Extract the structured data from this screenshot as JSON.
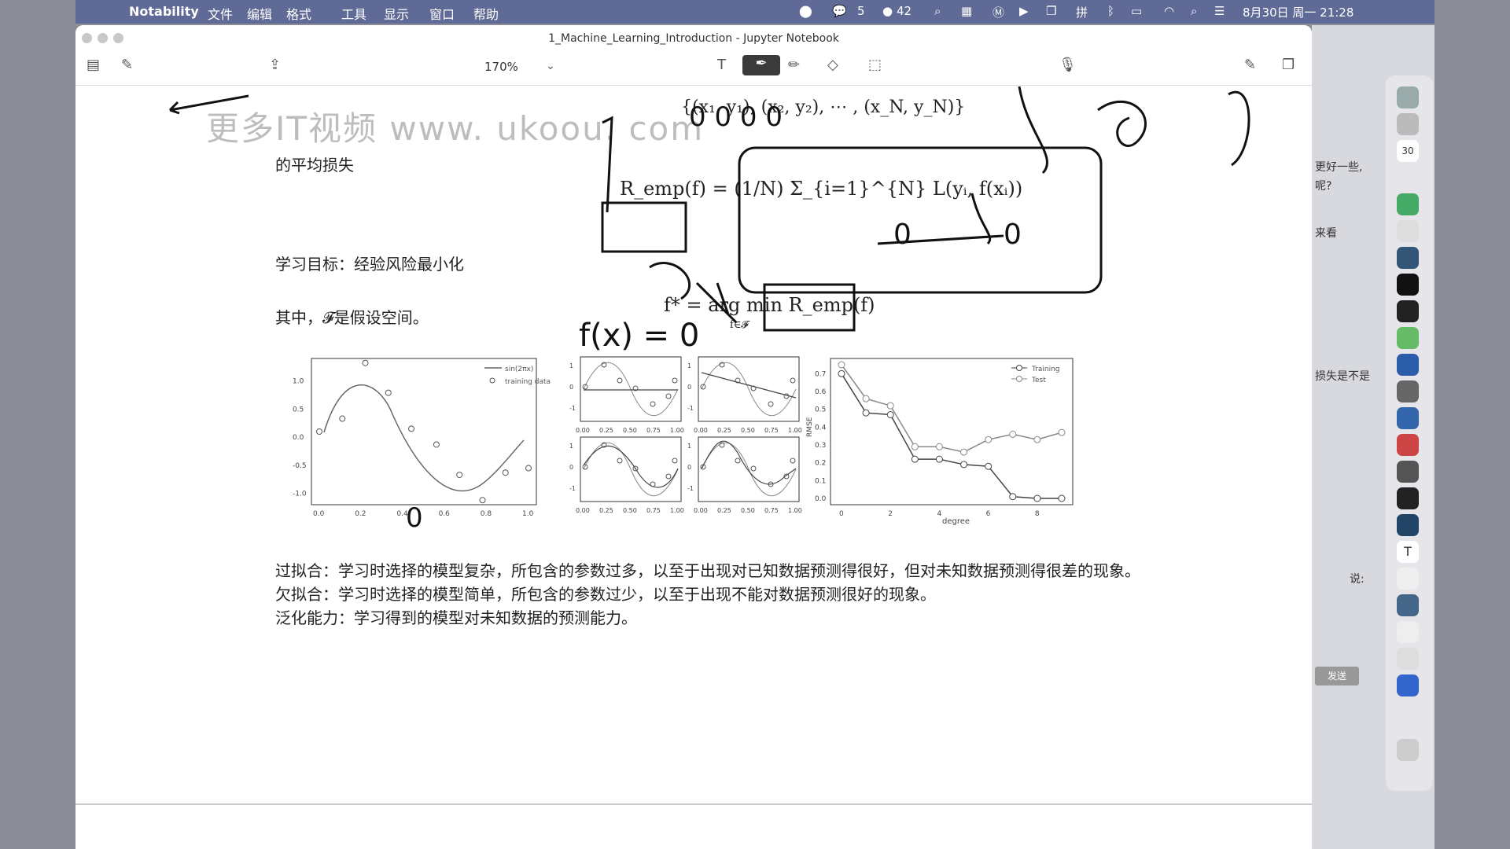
{
  "menubar": {
    "app": "Notability",
    "items": [
      "文件",
      "编辑",
      "格式",
      "工具",
      "显示",
      "窗口",
      "帮助"
    ],
    "status_wechat_count": "5",
    "status_bell_count": "42",
    "clock": "8月30日 周一 21:28"
  },
  "window": {
    "title": "1_Machine_Learning_Introduction - Jupyter Notebook",
    "zoom": "170%"
  },
  "page": {
    "watermark": "更多IT视频 www. ukoou. com",
    "avg_loss": "的平均损失",
    "objective": "学习目标：经验风险最小化",
    "hypothesis": "其中，𝓕是假设空间。",
    "overfitting": "过拟合：学习时选择的模型复杂，所包含的参数过多，以至于出现对已知数据预测得很好，但对未知数据预测得很差的现象。",
    "underfitting": "欠拟合：学习时选择的模型简单，所包含的参数过少，以至于出现不能对数据预测很好的现象。",
    "generalization": "泛化能力：学习得到的模型对未知数据的预测能力。",
    "formula_top": "{(x₁, y₁), (x₂, y₂), ⋯ , (x_N, y_N)}",
    "formula_remp": "R_emp(f) = (1/N) Σ_{i=1}^{N} L(yᵢ, f(xᵢ))",
    "formula_argmin": "f* = arg min R_emp(f)",
    "formula_argmin_sub": "f∈𝓕"
  },
  "handwriting": {
    "zero1": "0",
    "zero2": "0",
    "fx": "f(x) = 0",
    "zero_plot": "0"
  },
  "rightpanel": {
    "snippets": [
      "更好一些,",
      "呢?",
      "来看",
      "损失是不是"
    ],
    "send_btn": "发送",
    "say": "说:",
    "badge": "30"
  },
  "chart_data": [
    {
      "type": "scatter",
      "title": "",
      "xlabel": "",
      "ylabel": "",
      "xlim": [
        0,
        1
      ],
      "ylim": [
        -1.2,
        1.4
      ],
      "xticks": [
        "0.0",
        "0.2",
        "0.4",
        "0.6",
        "0.8",
        "1.0"
      ],
      "yticks": [
        "1.0",
        "0.5",
        "0.0",
        "-0.5",
        "-1.0"
      ],
      "legend": [
        "sin(2πx)",
        "training data"
      ],
      "series": [
        {
          "name": "training data",
          "x": [
            0.0,
            0.11,
            0.22,
            0.33,
            0.44,
            0.56,
            0.67,
            0.78,
            0.89,
            1.0
          ],
          "y": [
            0.1,
            0.33,
            1.32,
            0.79,
            0.15,
            -0.13,
            -0.67,
            -1.12,
            -0.63,
            -0.55
          ]
        }
      ]
    },
    {
      "type": "line",
      "panels": [
        {
          "xticks": [
            "0.00",
            "0.25",
            "0.50",
            "0.75",
            "1.00"
          ],
          "yticks": [
            "1",
            "0",
            "-1"
          ]
        },
        {
          "xticks": [
            "0.00",
            "0.25",
            "0.50",
            "0.75",
            "1.00"
          ],
          "yticks": [
            "1",
            "0",
            "-1"
          ]
        },
        {
          "xticks": [
            "0.00",
            "0.25",
            "0.50",
            "0.75",
            "1.00"
          ],
          "yticks": [
            "1",
            "0",
            "-1"
          ]
        },
        {
          "xticks": [
            "0.00",
            "0.25",
            "0.50",
            "0.75",
            "1.00"
          ],
          "yticks": [
            "1",
            "0",
            "-1"
          ]
        }
      ]
    },
    {
      "type": "line",
      "xlabel": "degree",
      "ylabel": "RMSE",
      "xlim": [
        0,
        9
      ],
      "ylim": [
        0,
        0.75
      ],
      "xticks": [
        "0",
        "2",
        "4",
        "6",
        "8"
      ],
      "yticks": [
        "0.7",
        "0.6",
        "0.5",
        "0.4",
        "0.3",
        "0.2",
        "0.1",
        "0.0"
      ],
      "legend": [
        "Training",
        "Test"
      ],
      "series": [
        {
          "name": "Training",
          "x": [
            0,
            1,
            2,
            3,
            4,
            5,
            6,
            7,
            8,
            9
          ],
          "y": [
            0.7,
            0.48,
            0.47,
            0.22,
            0.22,
            0.19,
            0.18,
            0.01,
            0.0,
            0.0
          ]
        },
        {
          "name": "Test",
          "x": [
            0,
            1,
            2,
            3,
            4,
            5,
            6,
            7,
            8,
            9
          ],
          "y": [
            0.75,
            0.56,
            0.52,
            0.29,
            0.29,
            0.26,
            0.33,
            0.36,
            0.33,
            0.37
          ]
        }
      ]
    }
  ]
}
